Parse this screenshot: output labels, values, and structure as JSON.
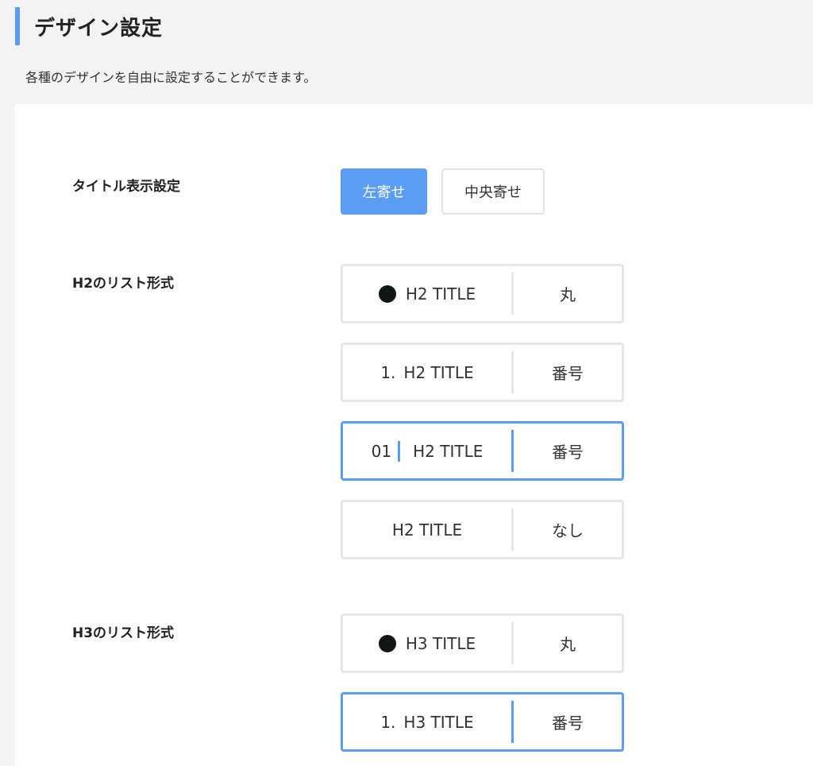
{
  "header": {
    "title": "デザイン設定",
    "description": "各種のデザインを自由に設定することができます。",
    "accent": "#5b9cf5"
  },
  "title_display": {
    "label": "タイトル表示設定",
    "options": [
      "左寄せ",
      "中央寄せ"
    ],
    "selected": "左寄せ"
  },
  "h2_list": {
    "label": "H2のリスト形式",
    "options": [
      {
        "marker": "dot",
        "text": "H2 TITLE",
        "name": "丸"
      },
      {
        "marker": "1.",
        "text": "H2 TITLE",
        "name": "番号"
      },
      {
        "marker": "01",
        "text": "H2 TITLE",
        "name": "番号"
      },
      {
        "marker": "",
        "text": "H2 TITLE",
        "name": "なし"
      }
    ],
    "selected_index": 2
  },
  "h3_list": {
    "label": "H3のリスト形式",
    "options": [
      {
        "marker": "dot",
        "text": "H3 TITLE",
        "name": "丸"
      },
      {
        "marker": "1.",
        "text": "H3 TITLE",
        "name": "番号"
      }
    ],
    "selected_index": 1
  }
}
